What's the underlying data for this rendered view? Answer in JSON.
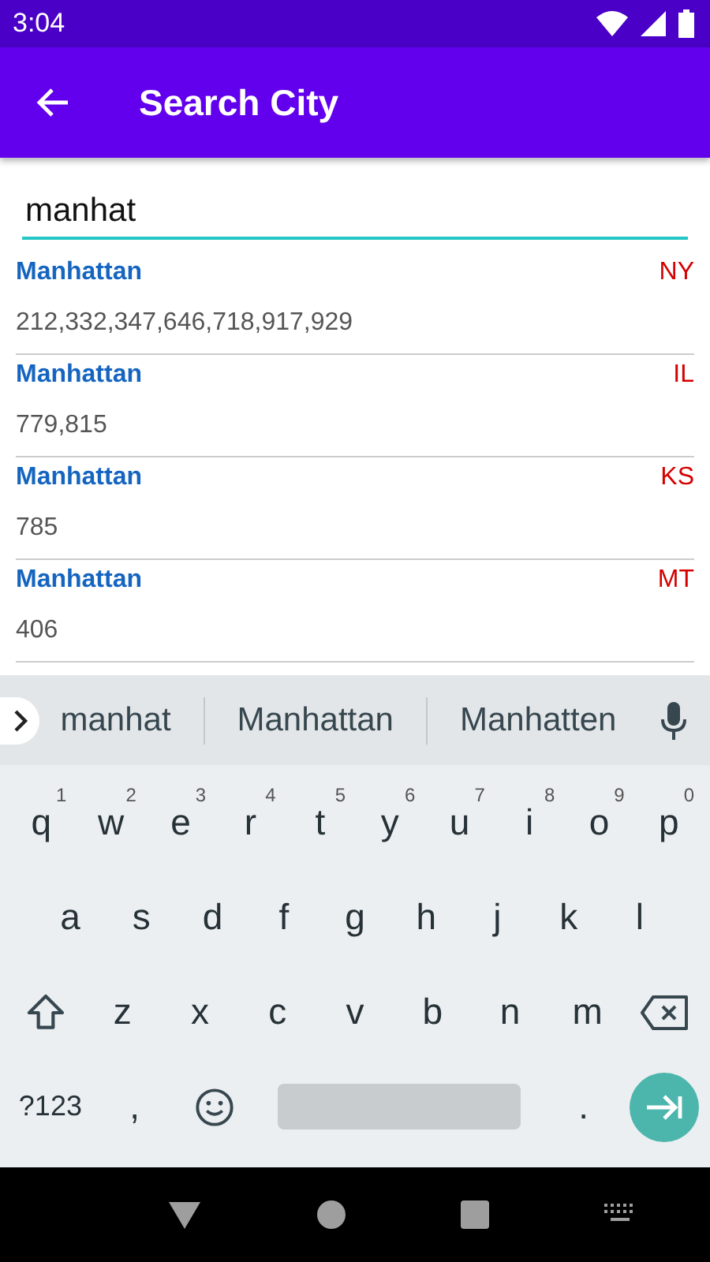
{
  "status_bar": {
    "time": "3:04"
  },
  "app_bar": {
    "title": "Search City"
  },
  "search": {
    "value": "manhat"
  },
  "results": [
    {
      "city": "Manhattan",
      "state": "NY",
      "area_codes": "212,332,347,646,718,917,929"
    },
    {
      "city": "Manhattan",
      "state": "IL",
      "area_codes": "779,815"
    },
    {
      "city": "Manhattan",
      "state": "KS",
      "area_codes": "785"
    },
    {
      "city": "Manhattan",
      "state": "MT",
      "area_codes": "406"
    }
  ],
  "keyboard": {
    "suggestions": [
      "manhat",
      "Manhattan",
      "Manhatten"
    ],
    "rows": [
      [
        {
          "key": "q",
          "hint": "1"
        },
        {
          "key": "w",
          "hint": "2"
        },
        {
          "key": "e",
          "hint": "3"
        },
        {
          "key": "r",
          "hint": "4"
        },
        {
          "key": "t",
          "hint": "5"
        },
        {
          "key": "y",
          "hint": "6"
        },
        {
          "key": "u",
          "hint": "7"
        },
        {
          "key": "i",
          "hint": "8"
        },
        {
          "key": "o",
          "hint": "9"
        },
        {
          "key": "p",
          "hint": "0"
        }
      ],
      [
        {
          "key": "a"
        },
        {
          "key": "s"
        },
        {
          "key": "d"
        },
        {
          "key": "f"
        },
        {
          "key": "g"
        },
        {
          "key": "h"
        },
        {
          "key": "j"
        },
        {
          "key": "k"
        },
        {
          "key": "l"
        }
      ],
      [
        {
          "kind": "shift"
        },
        {
          "key": "z"
        },
        {
          "key": "x"
        },
        {
          "key": "c"
        },
        {
          "key": "v"
        },
        {
          "key": "b"
        },
        {
          "key": "n"
        },
        {
          "key": "m"
        },
        {
          "kind": "backspace"
        }
      ],
      [
        {
          "kind": "symbols",
          "key": "?123"
        },
        {
          "key": ","
        },
        {
          "kind": "emoji"
        },
        {
          "kind": "space"
        },
        {
          "key": "."
        },
        {
          "kind": "enter"
        }
      ]
    ]
  }
}
